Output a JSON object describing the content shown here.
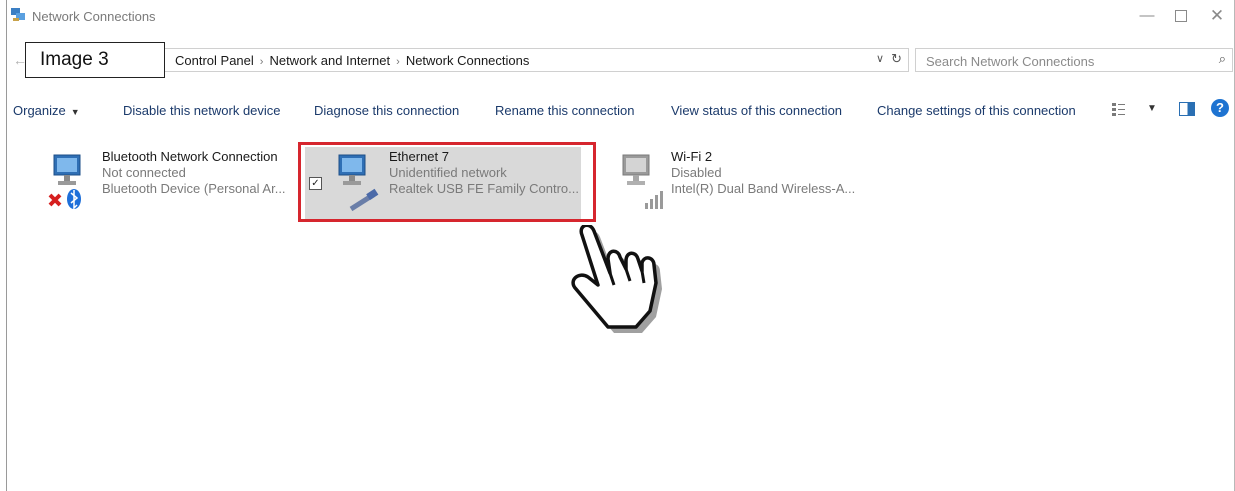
{
  "window": {
    "title": "Network Connections"
  },
  "annotation": {
    "label": "Image 3"
  },
  "address_bar": {
    "crumbs": [
      "Control Panel",
      "Network and Internet",
      "Network Connections"
    ],
    "separator": "›"
  },
  "search": {
    "placeholder": "Search Network Connections"
  },
  "commands": {
    "organize": "Organize",
    "disable": "Disable this network device",
    "diagnose": "Diagnose this connection",
    "rename": "Rename this connection",
    "status": "View status of this connection",
    "settings": "Change settings of this connection"
  },
  "connections": [
    {
      "name": "Bluetooth Network Connection",
      "status": "Not connected",
      "device": "Bluetooth Device (Personal Ar...",
      "icon": "bluetooth-network-icon",
      "selected": false
    },
    {
      "name": "Ethernet 7",
      "status": "Unidentified network",
      "device": "Realtek USB FE Family Contro...",
      "icon": "ethernet-network-icon",
      "selected": true
    },
    {
      "name": "Wi-Fi 2",
      "status": "Disabled",
      "device": "Intel(R) Dual Band Wireless-A...",
      "icon": "wifi-network-icon",
      "selected": false
    }
  ],
  "colors": {
    "highlight": "#d6262e",
    "selection": "#d9d9d9",
    "link": "#1b3a6b"
  }
}
